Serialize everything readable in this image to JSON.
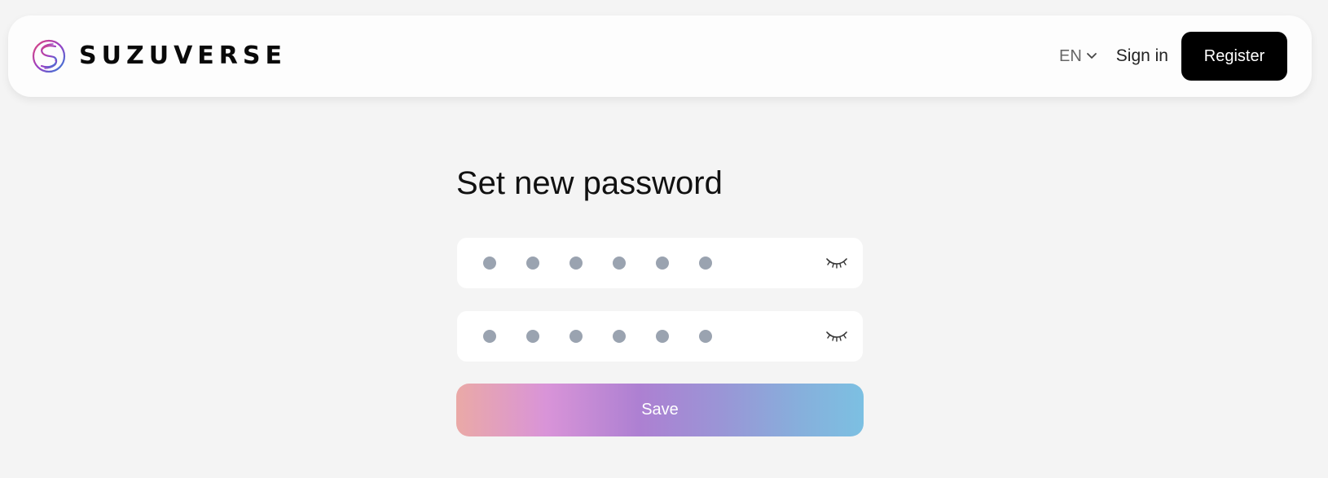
{
  "header": {
    "brand_name": "SUZUVERSE",
    "logo_icon": "suzuverse-logo-icon",
    "language": {
      "label": "EN",
      "icon": "chevron-down-icon"
    },
    "sign_in_label": "Sign in",
    "register_label": "Register"
  },
  "form": {
    "title": "Set new password",
    "password_field": {
      "masked_length": 6,
      "toggle_icon": "eye-closed-icon"
    },
    "confirm_password_field": {
      "masked_length": 6,
      "toggle_icon": "eye-closed-icon"
    },
    "save_label": "Save"
  },
  "colors": {
    "background": "#f4f4f4",
    "register_bg": "#000000",
    "mask_dot": "#9aa3b0",
    "save_gradient": [
      "#eaa9a6",
      "#d994d8",
      "#ad80d2",
      "#9a95d6",
      "#7cc0e2"
    ]
  }
}
